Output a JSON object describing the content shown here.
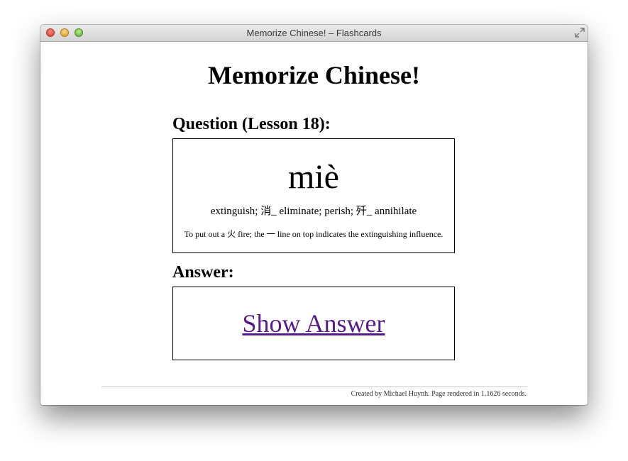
{
  "window": {
    "title": "Memorize Chinese! – Flashcards"
  },
  "page": {
    "title": "Memorize Chinese!",
    "question_heading": "Question (Lesson 18):",
    "question": {
      "pinyin": "miè",
      "meaning": "extinguish; 消_ eliminate; perish; 歼_ annihilate",
      "note": "To put out a 火 fire; the 一 line on top indicates the extinguishing influence."
    },
    "answer_heading": "Answer:",
    "show_answer_label": "Show Answer",
    "footer": "Created by Michael Huynh. Page rendered in 1.1626 seconds."
  }
}
